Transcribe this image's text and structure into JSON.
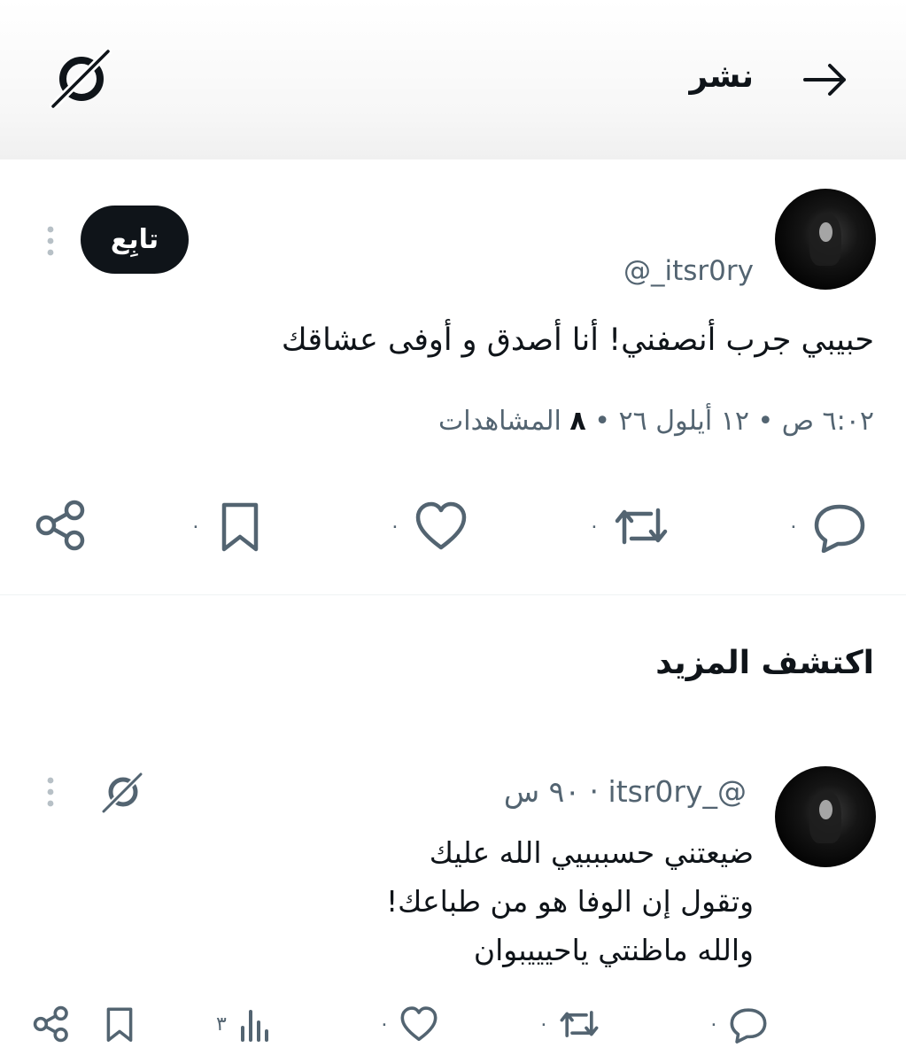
{
  "header": {
    "title": "نشر",
    "back_icon": "arrow-right-icon",
    "grok_icon": "grok-icon"
  },
  "post": {
    "handle": "@_itsr0ry",
    "follow_label": "تابِع",
    "text": "حبيبي جرب أنصفني! أنا أصدق و أوفى عشاقك",
    "meta_time": "٦:٠٢ ص • ١٢ أيلول ٢٦ •",
    "meta_views_count": "٨",
    "meta_views_label": "المشاهدات",
    "actions": {
      "reply_count": "٠",
      "repost_count": "٠",
      "like_count": "٠",
      "bookmark_count": "٠"
    }
  },
  "discover": {
    "title": "اكتشف المزيد"
  },
  "reply": {
    "handle_line": "@_itsr0ry · ٩٠ س",
    "lines": [
      "ضيعتني حسبببيي الله عليك",
      "وتقول إن الوفا هو من طباعك!",
      "والله ماظنتي ياحيييبوان"
    ],
    "actions": {
      "reply_count": "٠",
      "repost_count": "٠",
      "like_count": "٠",
      "views_count": "٣"
    }
  },
  "colors": {
    "text": "#0f1419",
    "secondary": "#536471",
    "button_bg": "#0f1419"
  }
}
